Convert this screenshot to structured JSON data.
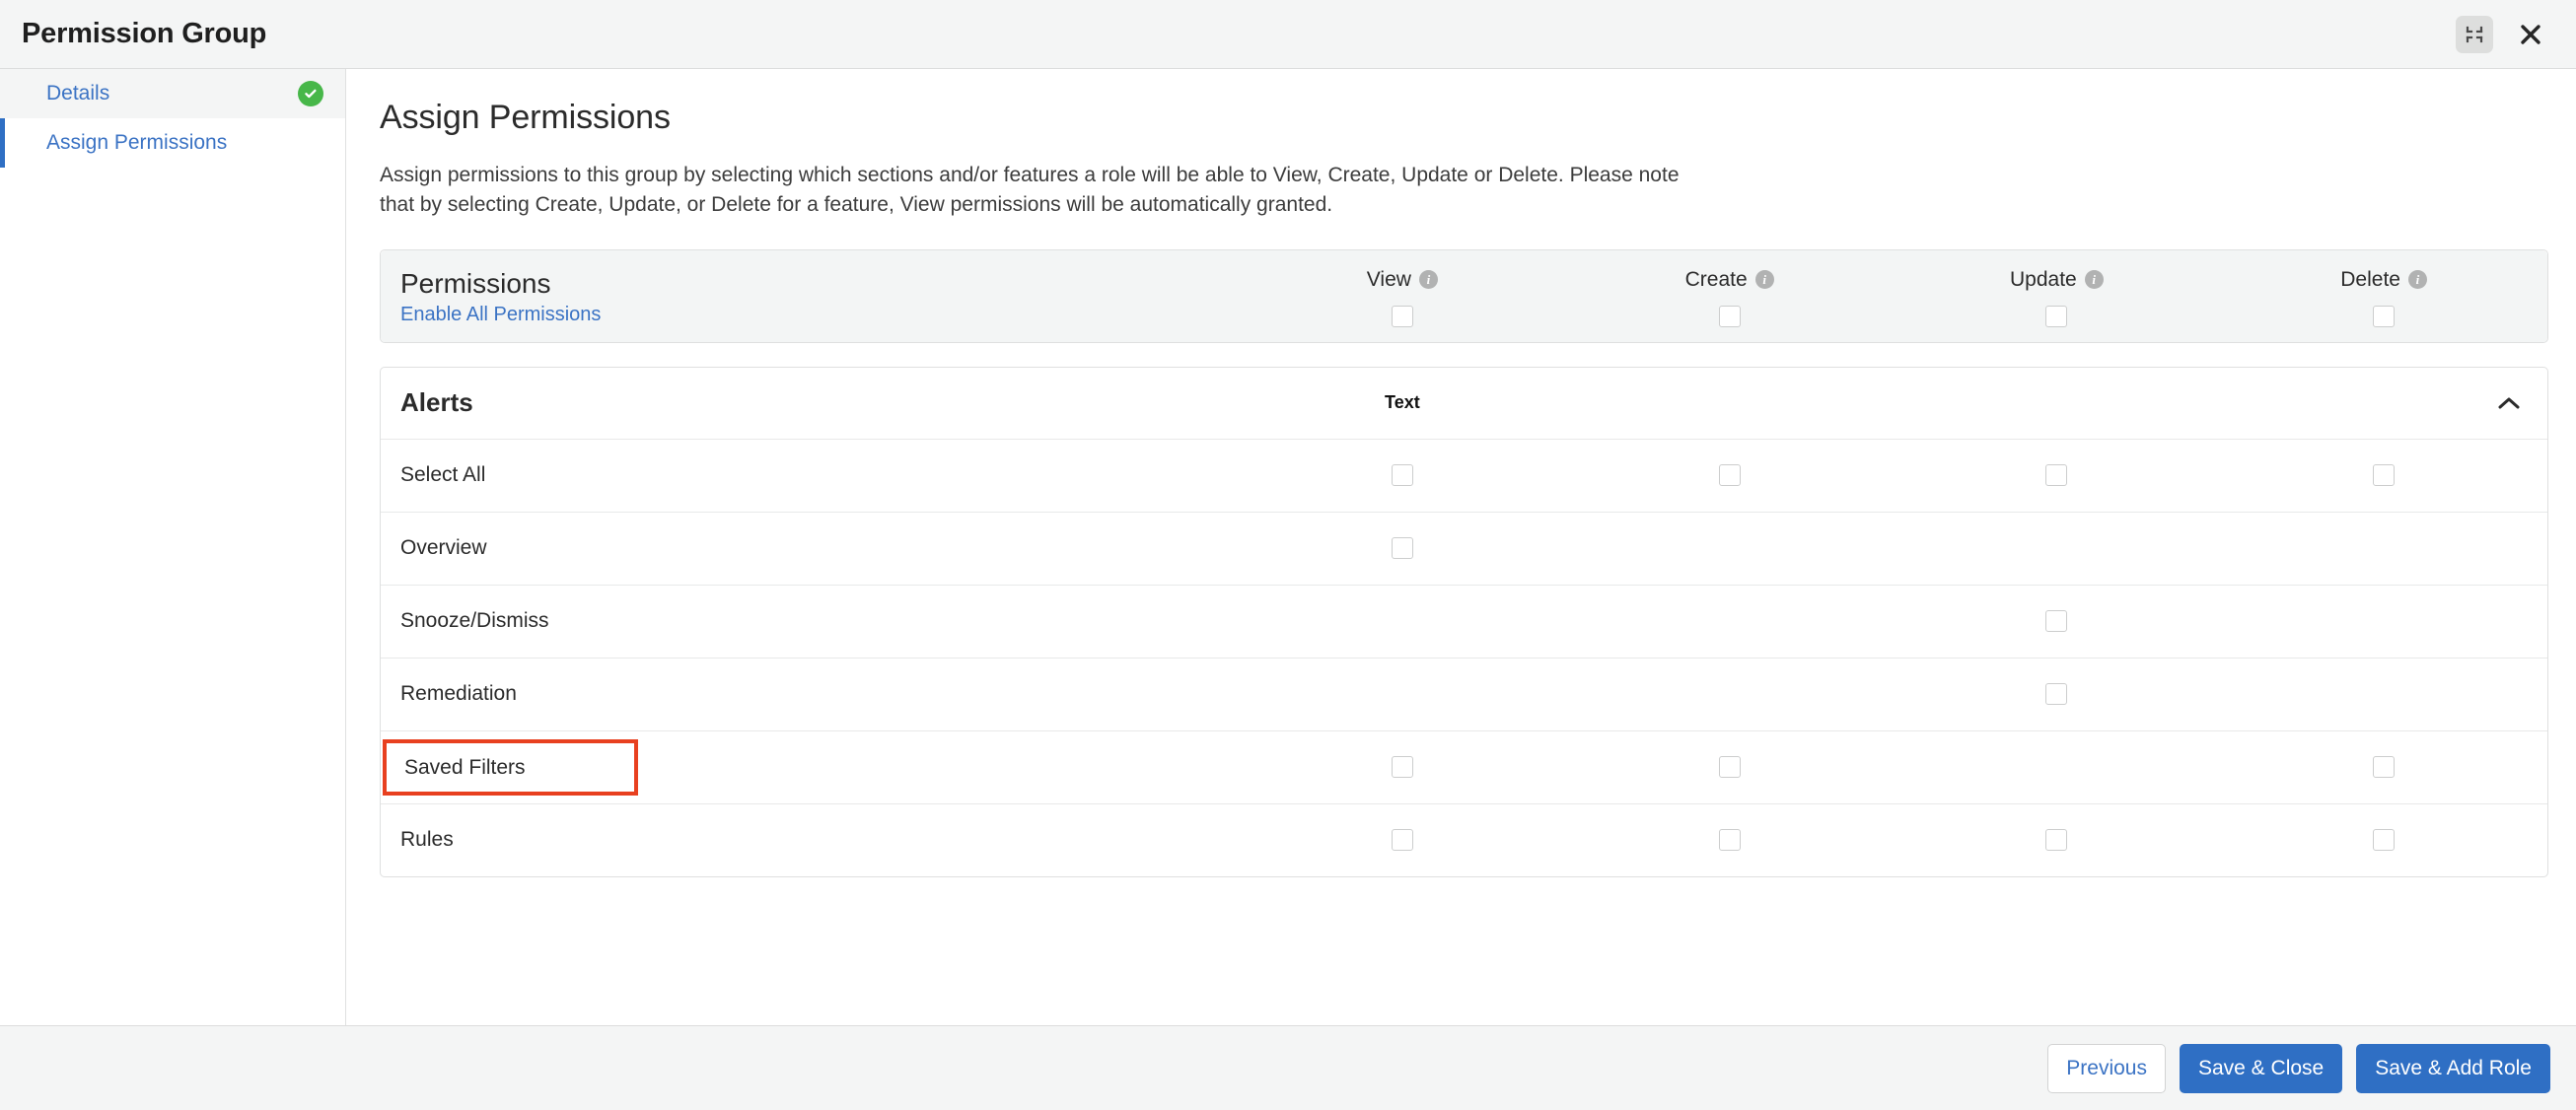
{
  "titlebar": {
    "title": "Permission Group",
    "minimize_icon": "collapse-icon",
    "close_icon": "close-icon"
  },
  "sidebar": {
    "items": [
      {
        "label": "Details",
        "state": "completed",
        "status_icon": "check-circle-icon"
      },
      {
        "label": "Assign Permissions",
        "state": "active"
      }
    ]
  },
  "main": {
    "title": "Assign Permissions",
    "description": "Assign permissions to this group by selecting which sections and/or features a role will be able to View, Create, Update or Delete. Please note that by selecting Create, Update, or Delete for a feature, View permissions will be automatically granted."
  },
  "permissions_card": {
    "title": "Permissions",
    "enable_all_label": "Enable All Permissions",
    "columns": [
      {
        "label": "View",
        "info_icon": "info-icon"
      },
      {
        "label": "Create",
        "info_icon": "info-icon"
      },
      {
        "label": "Update",
        "info_icon": "info-icon"
      },
      {
        "label": "Delete",
        "info_icon": "info-icon"
      }
    ],
    "header_checkboxes": [
      false,
      false,
      false,
      false
    ]
  },
  "alerts_card": {
    "title": "Alerts",
    "column_label": "Text",
    "collapse_icon": "chevron-up-icon",
    "rows": [
      {
        "label": "Select All",
        "checkboxes": [
          true,
          true,
          true,
          true
        ]
      },
      {
        "label": "Overview",
        "checkboxes": [
          true,
          false,
          false,
          false
        ]
      },
      {
        "label": "Snooze/Dismiss",
        "checkboxes": [
          false,
          false,
          true,
          false
        ]
      },
      {
        "label": "Remediation",
        "checkboxes": [
          false,
          false,
          true,
          false
        ]
      },
      {
        "label": "Saved Filters",
        "checkboxes": [
          true,
          true,
          false,
          true
        ],
        "highlighted": true
      },
      {
        "label": "Rules",
        "checkboxes": [
          true,
          true,
          true,
          true
        ]
      }
    ]
  },
  "footer": {
    "previous_label": "Previous",
    "save_close_label": "Save & Close",
    "save_add_role_label": "Save & Add Role"
  },
  "colors": {
    "accent_blue": "#2f6fc4",
    "link_blue": "#3b73c4",
    "success_green": "#47b749",
    "highlight_red": "#e8401f",
    "panel_grey": "#f4f5f5"
  }
}
